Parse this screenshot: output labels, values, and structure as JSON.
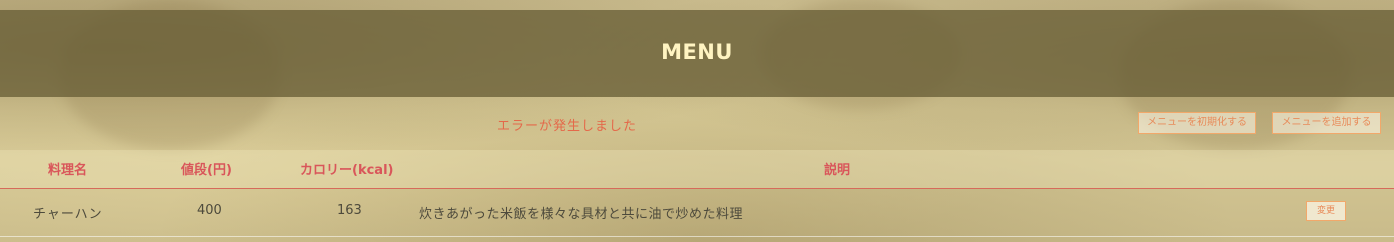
{
  "header": {
    "title": "MENU"
  },
  "status": {
    "error_message": "エラーが発生しました"
  },
  "actions": {
    "reset_label": "メニューを初期化する",
    "add_label": "メニューを追加する"
  },
  "table": {
    "columns": [
      "料理名",
      "値段(円)",
      "カロリー(kcal)",
      "説明"
    ],
    "rows": [
      {
        "name": "チャーハン",
        "price": "400",
        "calories": "163",
        "description": "炊きあがった米飯を様々な具材と共に油で炒めた料理",
        "edit_label": "変更"
      }
    ]
  },
  "colors": {
    "header_bg": "#695f37",
    "title_text": "#fff4c2",
    "accent": "#d9565a",
    "button_border": "#f2a86a",
    "error_text": "#e4694a"
  }
}
